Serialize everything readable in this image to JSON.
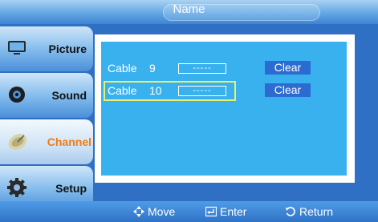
{
  "header": {
    "title": "Name"
  },
  "sidebar": {
    "items": [
      {
        "label": "Picture",
        "icon": "picture-icon"
      },
      {
        "label": "Sound",
        "icon": "speaker-icon"
      },
      {
        "label": "Channel",
        "icon": "satellite-dish-icon",
        "active": true
      },
      {
        "label": "Setup",
        "icon": "gear-icon"
      }
    ]
  },
  "main": {
    "rows": [
      {
        "name": "Cable",
        "number": "9",
        "field": "-----",
        "clear_label": "Clear"
      },
      {
        "name": "Cable",
        "number": "10",
        "field": "-----",
        "clear_label": "Clear"
      }
    ]
  },
  "footer": {
    "hints": [
      {
        "glyph": "move-icon",
        "label": "Move"
      },
      {
        "glyph": "enter-icon",
        "label": "Enter"
      },
      {
        "glyph": "return-icon",
        "label": "Return"
      }
    ]
  },
  "colors": {
    "accent": "#f07a12",
    "selection": "#e9f06a",
    "panel": "#39b1ef",
    "button": "#2c6bd0"
  }
}
